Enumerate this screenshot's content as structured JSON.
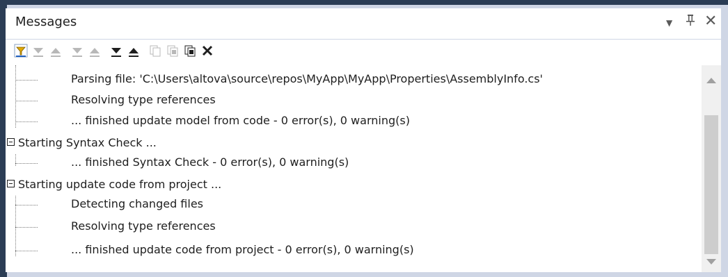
{
  "panel": {
    "title": "Messages",
    "controls": {
      "dropdown": "▼",
      "pin": "ᚚ",
      "close": "✕"
    }
  },
  "toolbar": {
    "buttons": [
      "filter-icon",
      "next-error-icon",
      "prev-error-icon",
      "next-warning-icon",
      "prev-warning-icon",
      "next-message-icon",
      "prev-message-icon",
      "copy-icon",
      "copy-selected-icon",
      "copy-all-icon",
      "clear-icon"
    ]
  },
  "messages": [
    {
      "level": "child",
      "text": "Parsing file: 'C:\\Users\\altova\\source\\repos\\MyApp\\MyApp\\Properties\\AssemblyInfo.cs'"
    },
    {
      "level": "child",
      "text": "Resolving type references"
    },
    {
      "level": "child",
      "text": "... finished update model from code - 0 error(s), 0 warning(s)"
    },
    {
      "level": "parent",
      "text": "Starting Syntax Check ..."
    },
    {
      "level": "child",
      "text": "... finished Syntax Check - 0 error(s), 0 warning(s)"
    },
    {
      "level": "parent",
      "text": "Starting update code from project ..."
    },
    {
      "level": "child",
      "text": "Detecting changed files"
    },
    {
      "level": "child",
      "text": "Resolving type references"
    },
    {
      "level": "child",
      "text": "... finished update code from project - 0 error(s), 0 warning(s)"
    }
  ]
}
